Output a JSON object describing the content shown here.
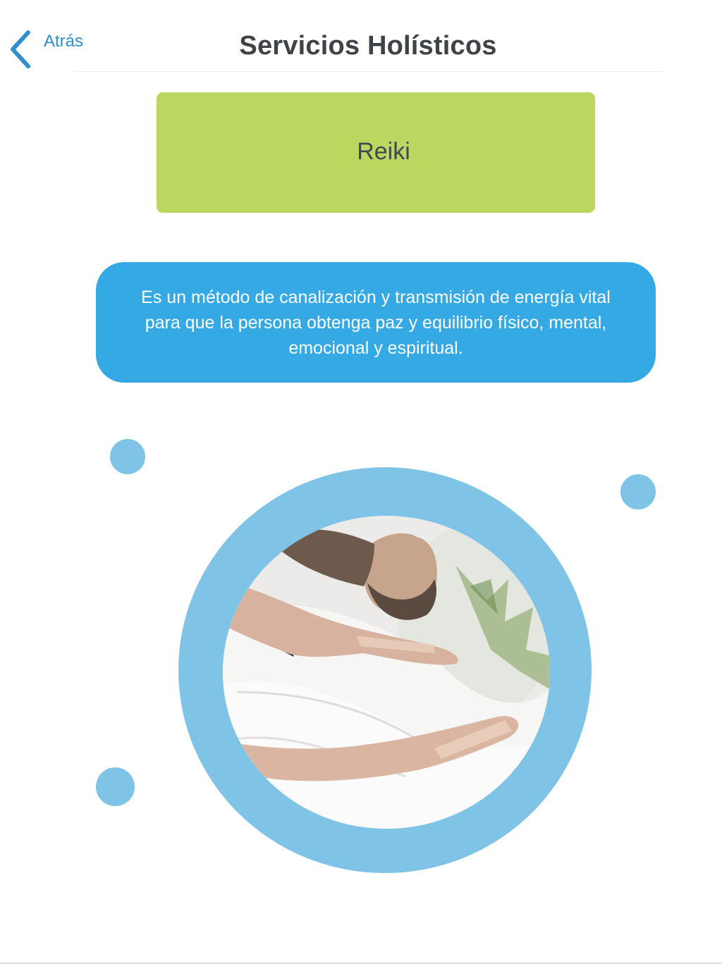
{
  "header": {
    "back_label": "Atrás",
    "title": "Servicios Holísticos"
  },
  "service": {
    "name": "Reiki",
    "description": "Es un método de canalización y transmisión de energía vital para que la persona obtenga paz y equilibrio físico, mental, emocional y espiritual."
  },
  "colors": {
    "accent_blue": "#2f8fcf",
    "card_green": "#bcd760",
    "description_blue": "#34a9e4",
    "decor_light_blue": "#7fc3e6"
  },
  "icons": {
    "back": "chevron-left-icon"
  }
}
